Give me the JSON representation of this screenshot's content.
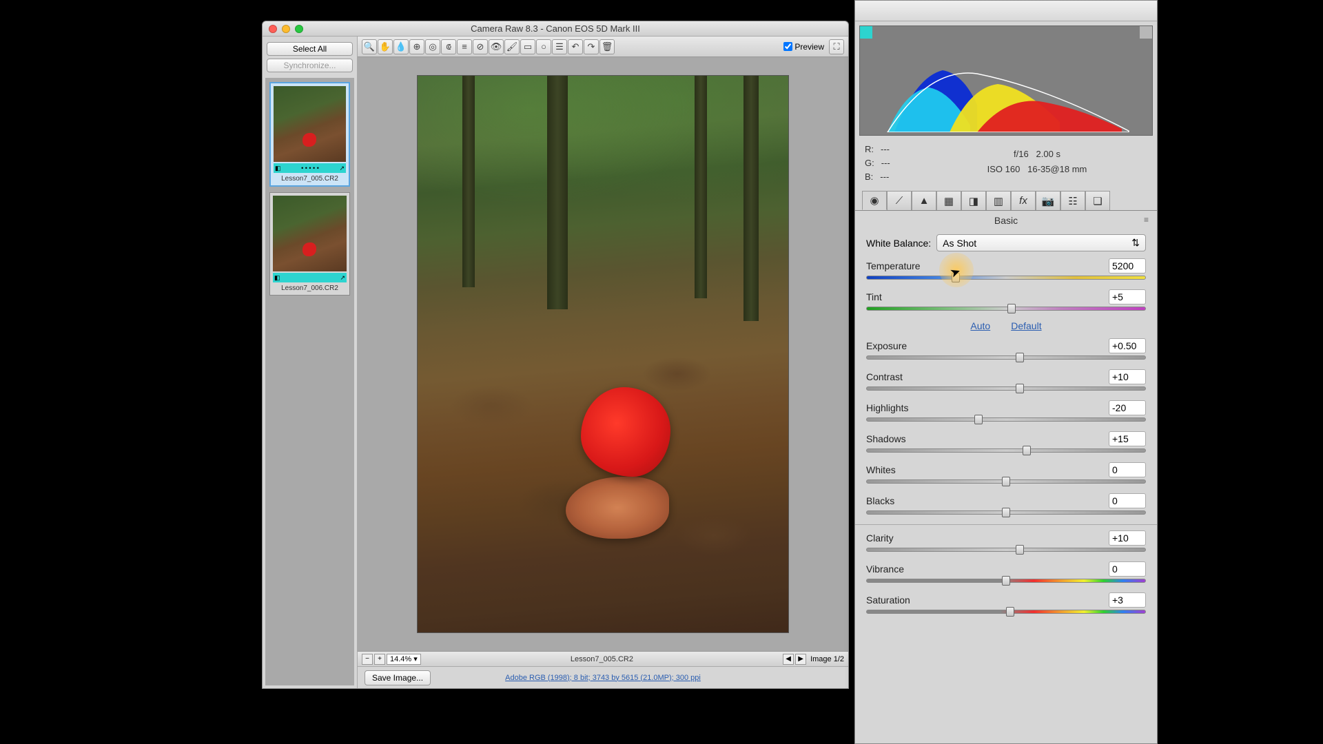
{
  "window": {
    "title": "Camera Raw 8.3  -  Canon EOS 5D Mark III"
  },
  "leftPane": {
    "selectAll": "Select All",
    "synchronize": "Synchronize...",
    "thumbs": [
      {
        "name": "Lesson7_005.CR2",
        "selected": true
      },
      {
        "name": "Lesson7_006.CR2",
        "selected": false
      }
    ]
  },
  "toolbar": {
    "previewLabel": "Preview",
    "previewChecked": true
  },
  "bottomBar": {
    "zoom": "14.4%",
    "filename": "Lesson7_005.CR2",
    "imageIndex": "Image 1/2"
  },
  "saveRow": {
    "saveLabel": "Save Image...",
    "metaLink": "Adobe RGB (1998); 8 bit; 3743 by 5615 (21.0MP); 300 ppi"
  },
  "rgb": {
    "r": "R:",
    "rv": "---",
    "g": "G:",
    "gv": "---",
    "b": "B:",
    "bv": "---"
  },
  "exif": {
    "line1a": "f/16",
    "line1b": "2.00 s",
    "line2a": "ISO 160",
    "line2b": "16-35@18 mm"
  },
  "panel": {
    "title": "Basic",
    "wbLabel": "White Balance:",
    "wbValue": "As Shot",
    "autoLabel": "Auto",
    "defaultLabel": "Default",
    "sliders": {
      "temperature": {
        "label": "Temperature",
        "value": "5200",
        "pos": 32
      },
      "tint": {
        "label": "Tint",
        "value": "+5",
        "pos": 52
      },
      "exposure": {
        "label": "Exposure",
        "value": "+0.50",
        "pos": 55
      },
      "contrast": {
        "label": "Contrast",
        "value": "+10",
        "pos": 55
      },
      "highlights": {
        "label": "Highlights",
        "value": "-20",
        "pos": 40
      },
      "shadows": {
        "label": "Shadows",
        "value": "+15",
        "pos": 57.5
      },
      "whites": {
        "label": "Whites",
        "value": "0",
        "pos": 50
      },
      "blacks": {
        "label": "Blacks",
        "value": "0",
        "pos": 50
      },
      "clarity": {
        "label": "Clarity",
        "value": "+10",
        "pos": 55
      },
      "vibrance": {
        "label": "Vibrance",
        "value": "0",
        "pos": 50
      },
      "saturation": {
        "label": "Saturation",
        "value": "+3",
        "pos": 51.5
      }
    }
  }
}
